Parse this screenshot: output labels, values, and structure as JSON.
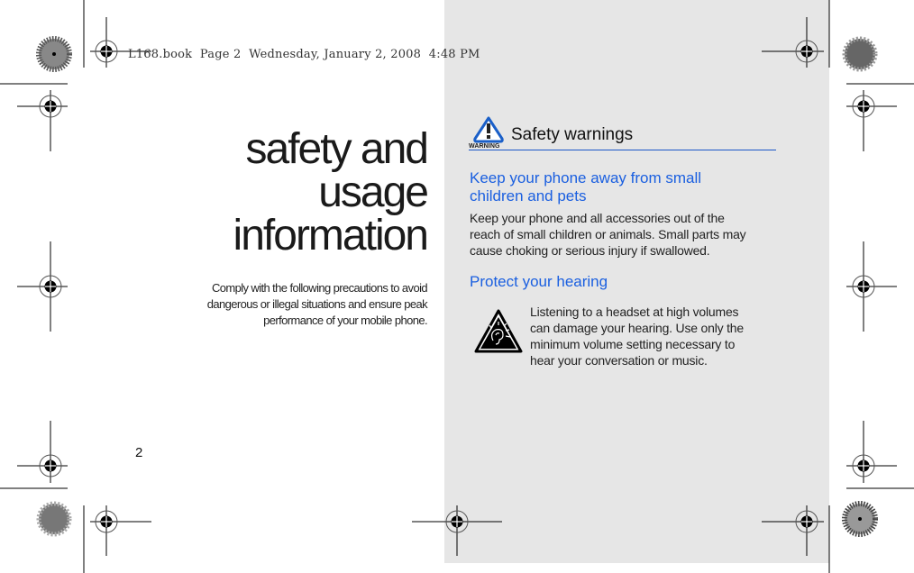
{
  "print_header": {
    "book": "L168.book",
    "page": "Page 2",
    "date": "Wednesday, January 2, 2008",
    "time": "4:48 PM"
  },
  "left_page": {
    "title_lines": [
      "safety and",
      "usage",
      "information"
    ],
    "intro_lines": [
      "Comply with the following precautions to avoid",
      "dangerous or illegal situations and ensure peak",
      "performance of your mobile phone."
    ],
    "page_number": "2"
  },
  "right_page": {
    "section": {
      "icon": "warning-triangle-icon",
      "icon_caption": "WARNING",
      "title": "Safety warnings",
      "accent_color": "#1a56c8"
    },
    "topics": [
      {
        "heading_lines": [
          "Keep your phone away from small",
          "children and pets"
        ],
        "body_lines": [
          "Keep your phone and all accessories out of the",
          "reach of small children or animals. Small parts may",
          "cause choking or serious injury if swallowed."
        ]
      },
      {
        "heading_lines": [
          "Protect your hearing"
        ],
        "icon": "hearing-damage-warning-icon",
        "body_lines": [
          "Listening to a headset at high volumes",
          "can damage your hearing. Use only the",
          "minimum volume setting necessary to",
          "hear your conversation or music."
        ]
      }
    ],
    "heading_color": "#1a5fe0",
    "panel_color": "#e6e6e6"
  }
}
